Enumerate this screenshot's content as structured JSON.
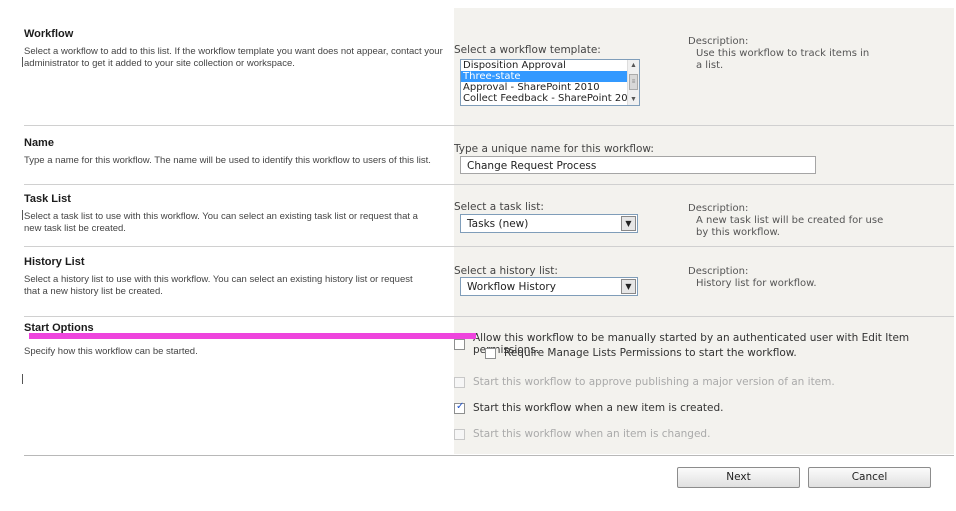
{
  "workflow": {
    "title": "Workflow",
    "description": "Select a workflow to add to this list. If the workflow template you want does not appear, contact your administrator to get it added to your site collection or workspace.",
    "template_label": "Select a workflow template:",
    "templates": [
      {
        "label": "Disposition Approval"
      },
      {
        "label": "Three-state"
      },
      {
        "label": "Approval - SharePoint 2010"
      },
      {
        "label": "Collect Feedback - SharePoint 20"
      }
    ],
    "selected_index": 1,
    "desc_label": "Description:",
    "desc_text": "Use this workflow to track items in a list."
  },
  "name": {
    "title": "Name",
    "description": "Type a name for this workflow. The name will be used to identify this workflow to users of this list.",
    "input_label": "Type a unique name for this workflow:",
    "value": "Change Request Process"
  },
  "task_list": {
    "title": "Task List",
    "description": "Select a task list to use with this workflow. You can select an existing task list or request that a new task list be created.",
    "select_label": "Select a task list:",
    "selected": "Tasks (new)",
    "desc_label": "Description:",
    "desc_text": "A new task list will be created for use by this workflow."
  },
  "history_list": {
    "title": "History List",
    "description": "Select a history list to use with this workflow. You can select an existing history list or request that a new history list be created.",
    "select_label": "Select a history list:",
    "selected": "Workflow History",
    "desc_label": "Description:",
    "desc_text": "History list for workflow."
  },
  "start_options": {
    "title": "Start Options",
    "description": "Specify how this workflow can be started.",
    "opt_manual": "Allow this workflow to be manually started by an authenticated user with Edit Item permissions.",
    "opt_manage_lists": "Require Manage Lists Permissions to start the workflow.",
    "opt_publish": "Start this workflow to approve publishing a major version of an item.",
    "opt_created": "Start this workflow when a new item is created.",
    "opt_changed": "Start this workflow when an item is changed."
  },
  "buttons": {
    "next": "Next",
    "cancel": "Cancel"
  },
  "colors": {
    "selection": "#3399ff",
    "highlight_bar": "#ee44dd",
    "panel_bg": "#f3f2ee"
  }
}
